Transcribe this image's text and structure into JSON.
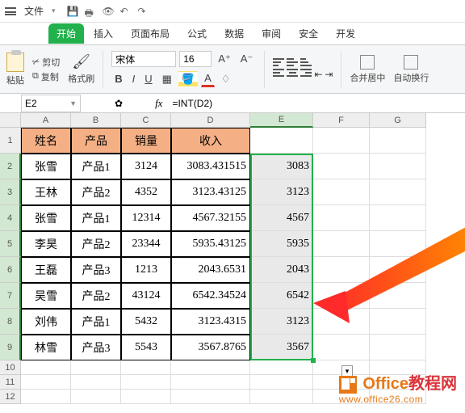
{
  "menubar": {
    "file": "文件"
  },
  "tabs": {
    "start": "开始",
    "insert": "插入",
    "layout": "页面布局",
    "formula": "公式",
    "data": "数据",
    "review": "审阅",
    "view": "",
    "security": "安全",
    "dev": "开发"
  },
  "ribbon": {
    "paste": "粘贴",
    "cut": "剪切",
    "copy": "复制",
    "format_painter": "格式刷",
    "font_name": "宋体",
    "font_size": "16",
    "merge": "合并居中",
    "wrap": "自动换行"
  },
  "ref": {
    "cell": "E2",
    "formula": "=INT(D2)"
  },
  "columns": [
    "A",
    "B",
    "C",
    "D",
    "E",
    "F",
    "G"
  ],
  "headers": {
    "name": "姓名",
    "product": "产品",
    "qty": "销量",
    "income": "收入"
  },
  "rows": [
    {
      "name": "张雪",
      "product": "产品1",
      "qty": "3124",
      "income": "3083.431515",
      "int": "3083"
    },
    {
      "name": "王林",
      "product": "产品2",
      "qty": "4352",
      "income": "3123.43125",
      "int": "3123"
    },
    {
      "name": "张雪",
      "product": "产品1",
      "qty": "12314",
      "income": "4567.32155",
      "int": "4567"
    },
    {
      "name": "李昊",
      "product": "产品2",
      "qty": "23344",
      "income": "5935.43125",
      "int": "5935"
    },
    {
      "name": "王磊",
      "product": "产品3",
      "qty": "1213",
      "income": "2043.6531",
      "int": "2043"
    },
    {
      "name": "吴雪",
      "product": "产品2",
      "qty": "43124",
      "income": "6542.34524",
      "int": "6542"
    },
    {
      "name": "刘伟",
      "product": "产品1",
      "qty": "5432",
      "income": "3123.4315",
      "int": "3123"
    },
    {
      "name": "林雪",
      "product": "产品3",
      "qty": "5543",
      "income": "3567.8765",
      "int": "3567"
    }
  ],
  "watermark": {
    "brand": "Office",
    "brand2": "教程网",
    "url": "www.office26.com"
  }
}
